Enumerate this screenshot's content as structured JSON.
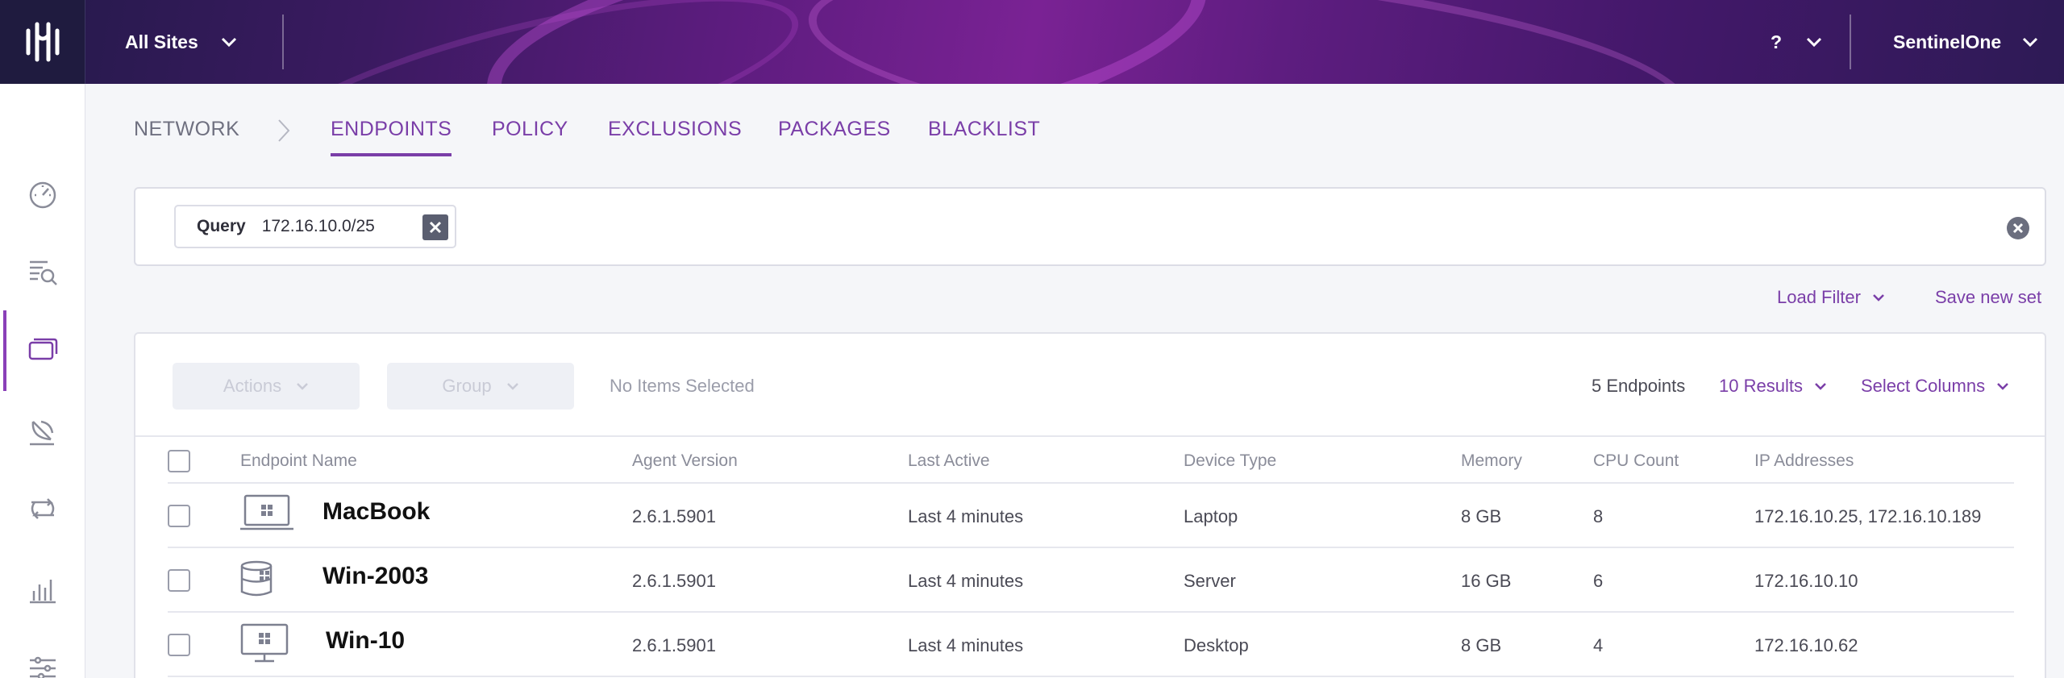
{
  "header": {
    "site_selector": "All Sites",
    "help": "?",
    "user": "SentinelOne"
  },
  "sidebar": {
    "items": [
      {
        "icon": "dashboard-gauge-icon"
      },
      {
        "icon": "search-list-icon"
      },
      {
        "icon": "monitor-icon",
        "active": true
      },
      {
        "icon": "satellite-dish-icon"
      },
      {
        "icon": "exchange-arrows-icon"
      },
      {
        "icon": "bar-chart-icon"
      },
      {
        "icon": "sliders-icon"
      }
    ]
  },
  "nav": {
    "breadcrumb": "NETWORK",
    "tabs": [
      {
        "label": "ENDPOINTS",
        "active": true
      },
      {
        "label": "POLICY"
      },
      {
        "label": "EXCLUSIONS"
      },
      {
        "label": "PACKAGES"
      },
      {
        "label": "BLACKLIST"
      }
    ]
  },
  "search": {
    "chip_key": "Query",
    "chip_value": "172.16.10.0/25"
  },
  "filters": {
    "load_filter": "Load Filter",
    "save_new_set": "Save new set"
  },
  "toolbar": {
    "actions_label": "Actions",
    "group_label": "Group",
    "selection_status": "No Items Selected",
    "endpoint_count": "5 Endpoints",
    "results": "10 Results",
    "select_columns": "Select Columns"
  },
  "table": {
    "columns": [
      "Endpoint Name",
      "Agent Version",
      "Last Active",
      "Device Type",
      "Memory",
      "CPU Count",
      "IP Addresses"
    ],
    "rows": [
      {
        "device_icon": "laptop-windows-icon",
        "name": "MacBook",
        "agent_version": "2.6.1.5901",
        "last_active": "Last 4 minutes",
        "device_type": "Laptop",
        "memory": "8 GB",
        "cpu": "8",
        "ip": "172.16.10.25, 172.16.10.189"
      },
      {
        "device_icon": "server-windows-icon",
        "name": "Win-2003",
        "agent_version": "2.6.1.5901",
        "last_active": "Last 4 minutes",
        "device_type": "Server",
        "memory": "16 GB",
        "cpu": "6",
        "ip": "172.16.10.10"
      },
      {
        "device_icon": "desktop-windows-icon",
        "name": "Win-10",
        "agent_version": "2.6.1.5901",
        "last_active": "Last 4 minutes",
        "device_type": "Desktop",
        "memory": "8 GB",
        "cpu": "4",
        "ip": "172.16.10.62"
      }
    ]
  },
  "colors": {
    "accent": "#7a3ea8",
    "header_bg": "#4a1a70",
    "logo_bg": "#1f1b3f"
  }
}
